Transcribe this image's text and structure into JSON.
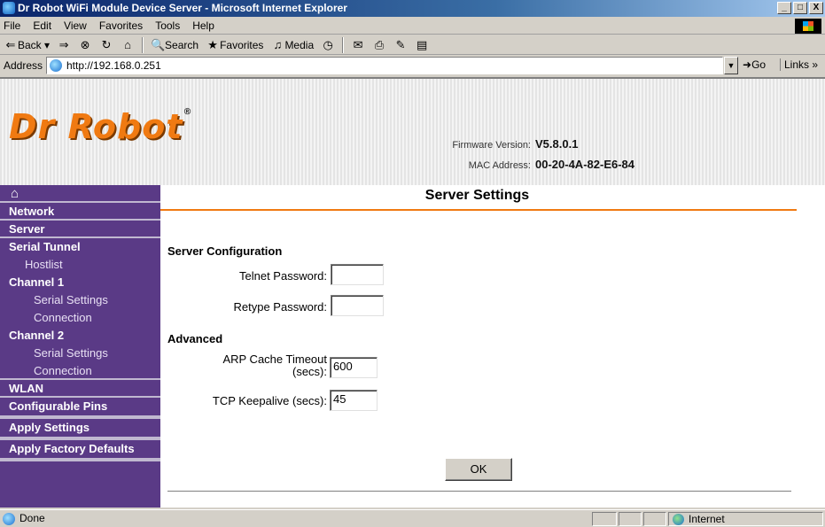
{
  "window": {
    "title": "Dr Robot WiFi Module Device Server - Microsoft Internet Explorer",
    "buttons": [
      "_",
      "□",
      "X"
    ]
  },
  "menu": [
    "File",
    "Edit",
    "View",
    "Favorites",
    "Tools",
    "Help"
  ],
  "toolbar": {
    "back": "Back",
    "search": "Search",
    "favorites": "Favorites",
    "media": "Media"
  },
  "address": {
    "label": "Address",
    "url": "http://192.168.0.251",
    "go": "Go",
    "links": "Links"
  },
  "header": {
    "logo": "Dr Robot",
    "logo_mark": "®",
    "firmware_label": "Firmware Version:",
    "firmware_value": "V5.8.0.1",
    "mac_label": "MAC Address:",
    "mac_value": "00-20-4A-82-E6-84",
    "accent_color": "#f07a12"
  },
  "sidebar": {
    "home_icon": "home-icon",
    "items": [
      {
        "label": "Network"
      },
      {
        "label": "Server"
      },
      {
        "label": "Serial Tunnel"
      },
      {
        "label": "Hostlist"
      },
      {
        "label": "Channel 1"
      },
      {
        "label": "Serial Settings"
      },
      {
        "label": "Connection"
      },
      {
        "label": "Channel 2"
      },
      {
        "label": "Serial Settings"
      },
      {
        "label": "Connection"
      },
      {
        "label": "WLAN"
      },
      {
        "label": "Configurable Pins"
      },
      {
        "label": "Apply Settings"
      },
      {
        "label": "Apply Factory Defaults"
      }
    ],
    "bg_color": "#5a3a86"
  },
  "main": {
    "title": "Server Settings",
    "server_config_heading": "Server Configuration",
    "telnet_password_label": "Telnet Password:",
    "telnet_password_value": "",
    "retype_password_label": "Retype Password:",
    "retype_password_value": "",
    "advanced_heading": "Advanced",
    "arp_label_1": "ARP Cache Timeout",
    "arp_label_2": "(secs):",
    "arp_value": "600",
    "keepalive_label": "TCP Keepalive (secs):",
    "keepalive_value": "45",
    "ok_label": "OK"
  },
  "status": {
    "text": "Done",
    "zone": "Internet"
  }
}
